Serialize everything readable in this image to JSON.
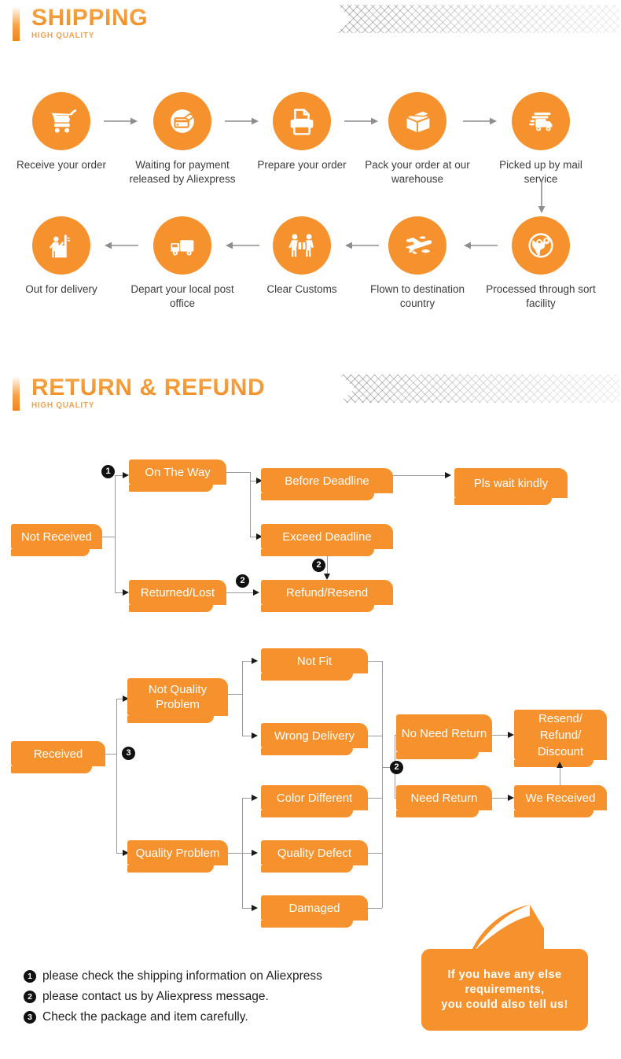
{
  "sections": {
    "shipping": {
      "title": "SHIPPING",
      "subtitle": "HIGH QUALITY"
    },
    "return": {
      "title": "RETURN & REFUND",
      "subtitle": "HIGH QUALITY"
    }
  },
  "shipping_steps": [
    {
      "icon": "shopping-cart-icon",
      "label": "Receive your order"
    },
    {
      "icon": "payment-card-icon",
      "label": "Waiting for payment released by Aliexpress"
    },
    {
      "icon": "printer-icon",
      "label": "Prepare your order"
    },
    {
      "icon": "package-box-icon",
      "label": "Pack your order at our warehouse"
    },
    {
      "icon": "fast-truck-icon",
      "label": "Picked up by mail service"
    },
    {
      "icon": "globe-pin-icon",
      "label": "Processed through sort facility"
    },
    {
      "icon": "airplane-icon",
      "label": "Flown to destination country"
    },
    {
      "icon": "customs-workers-icon",
      "label": "Clear Customs"
    },
    {
      "icon": "delivery-truck-icon",
      "label": "Depart your local post office"
    },
    {
      "icon": "doorstep-delivery-icon",
      "label": "Out for delivery"
    }
  ],
  "not_received_flow": {
    "root": "Not Received",
    "on_the_way": "On The Way",
    "returned_lost": "Returned/Lost",
    "before_deadline": "Before Deadline",
    "exceed_deadline": "Exceed Deadline",
    "refund_resend": "Refund/Resend",
    "pls_wait": "Pls wait kindly",
    "badges": {
      "b1": "1",
      "b2_mid": "2",
      "b2_low": "2"
    }
  },
  "received_flow": {
    "root": "Received",
    "not_quality": "Not Quality Problem",
    "quality": "Quality Problem",
    "not_fit": "Not Fit",
    "wrong_delivery": "Wrong Delivery",
    "color_different": "Color Different",
    "quality_defect": "Quality Defect",
    "damaged": "Damaged",
    "no_need_return": "No Need Return",
    "need_return": "Need Return",
    "we_received": "We Received",
    "resend_refund_discount": "Resend/ Refund/ Discount",
    "badges": {
      "b3": "3",
      "b2": "2"
    }
  },
  "legend": [
    {
      "num": "1",
      "text": "please check the shipping information on Aliexpress"
    },
    {
      "num": "2",
      "text": "please contact us by Aliexpress message."
    },
    {
      "num": "3",
      "text": "Check the package and item carefully."
    }
  ],
  "callout": {
    "line1": "If you have any else",
    "line2": "requirements,",
    "line3": "you could also tell us!"
  },
  "colors": {
    "orange": "#f5922e",
    "line": "#9a9a9a",
    "arrow": "#1a1a1a",
    "text": "#3c3c3c"
  }
}
